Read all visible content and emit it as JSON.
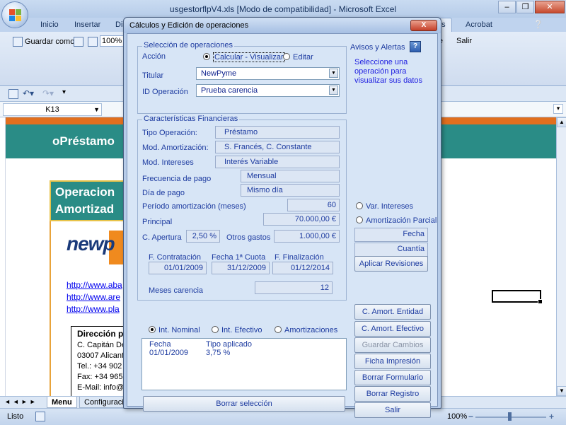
{
  "window": {
    "title": "usgestorflpV4.xls  [Modo de compatibilidad] - Microsoft Excel"
  },
  "ribbon": {
    "tabs": [
      "Inicio",
      "Insertar",
      "Dis",
      "Acrobat"
    ],
    "active_tab_partial": "os",
    "items": {
      "save_as": "Guardar como",
      "zoom": "100%",
      "right_a": "orte",
      "right_b": "Salir"
    }
  },
  "formula_bar": {
    "name_box": "K13"
  },
  "sheet": {
    "header_text": "oPréstamo",
    "op_box": [
      "Operacion",
      "Amortizad"
    ],
    "logo_text": "newp",
    "links": [
      "http://www.aba",
      "http://www.are",
      "http://www.pla"
    ],
    "direccion": {
      "title": "Dirección po",
      "lines": [
        "C. Capitán  De",
        "03007 Alicant",
        "Tel.: +34 902",
        "Fax:  +34 965",
        "E-Mail: info@"
      ]
    },
    "tabs": [
      "Menu",
      "Configuracion"
    ],
    "status": "Listo",
    "zoom": "100%"
  },
  "dialog": {
    "title": "Cálculos y Edición de operaciones",
    "close": "X",
    "seleccion": {
      "group_title": "Selección de operaciones",
      "accion_label": "Acción",
      "radio_calcular": "Calcular - Visualizar",
      "radio_editar": "Editar",
      "titular_label": "Titular",
      "titular_value": "NewPyme",
      "id_label": "ID Operación",
      "id_value": "Prueba carencia"
    },
    "avisos": {
      "title": "Avisos y Alertas",
      "help": "?",
      "message": [
        "Seleccione una",
        "operación para",
        "visualizar sus datos"
      ]
    },
    "caracteristicas": {
      "group_title": "Características Financieras",
      "tipo_label": "Tipo Operación:",
      "tipo_value": "Préstamo",
      "mod_amort_label": "Mod. Amortización:",
      "mod_amort_value": "S. Francés, C. Constante",
      "mod_int_label": "Mod. Intereses",
      "mod_int_value": "Interés Variable",
      "frecuencia_label": "Frecuencia de pago",
      "frecuencia_value": "Mensual",
      "dia_label": "Día de pago",
      "dia_value": "Mismo día",
      "periodo_label": "Período amortización (meses)",
      "periodo_value": "60",
      "principal_label": "Principal",
      "principal_value": "70.000,00 €",
      "apertura_label": "C. Apertura",
      "apertura_value": "2,50 %",
      "otros_label": "Otros gastos",
      "otros_value": "1.000,00 €",
      "f_contratacion_label": "F. Contratación",
      "f_contratacion_value": "01/01/2009",
      "f_cuota_label": "Fecha 1ª Cuota",
      "f_cuota_value": "31/12/2009",
      "f_finalizacion_label": "F. Finalización",
      "f_finalizacion_value": "01/12/2014",
      "meses_carencia_label": "Meses carencia",
      "meses_carencia_value": "12"
    },
    "revisiones": {
      "radio_var_intereses": "Var. Intereses",
      "radio_amort_parcial": "Amortización Parcial",
      "fecha_label": "Fecha",
      "cuantia_label": "Cuantía",
      "aplicar_button": "Aplicar Revisiones"
    },
    "tabla": {
      "radio_nominal": "Int. Nominal",
      "radio_efectivo": "Int. Efectivo",
      "radio_amortizaciones": "Amortizaciones",
      "headers": [
        "Fecha",
        "Tipo aplicado"
      ],
      "rows": [
        [
          "01/01/2009",
          "3,75 %"
        ]
      ],
      "borrar_seleccion": "Borrar selección"
    },
    "buttons": {
      "amort_entidad": "C. Amort. Entidad",
      "amort_efectivo": "C. Amort. Efectivo",
      "guardar": "Guardar Cambios",
      "ficha": "Ficha Impresión",
      "borrar_formulario": "Borrar Formulario",
      "borrar_registro": "Borrar Registro",
      "salir": "Salir"
    }
  }
}
